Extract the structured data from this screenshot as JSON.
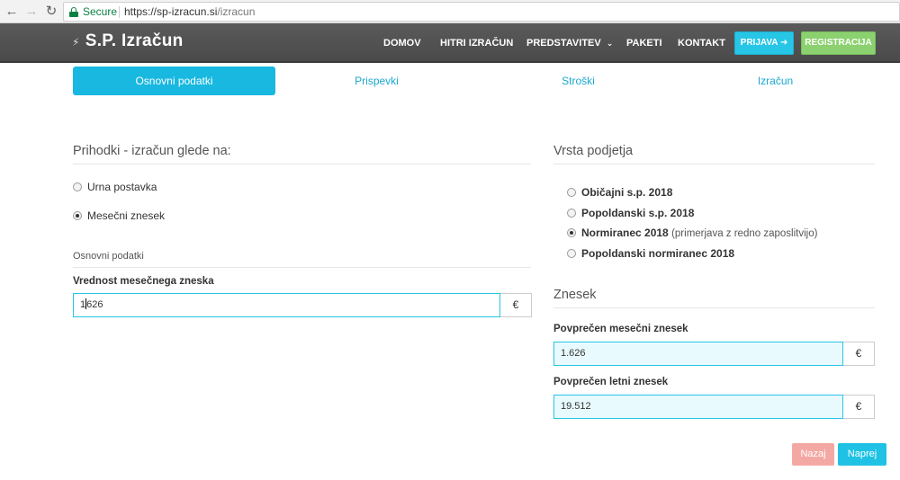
{
  "browser": {
    "security_label": "Secure",
    "url_host": "https://sp-izracun.si",
    "url_path": "/izracun"
  },
  "navbar": {
    "brand": "S.P. Izračun",
    "items": [
      "DOMOV",
      "HITRI IZRAČUN",
      "PREDSTAVITEV",
      "PAKETI",
      "KONTAKT"
    ],
    "login_label": "PRIJAVA",
    "register_label": "REGISTRACIJA"
  },
  "tabs": [
    "Osnovni podatki",
    "Prispevki",
    "Stroški",
    "Izračun"
  ],
  "left": {
    "section_title": "Prihodki - izračun glede na:",
    "radios": [
      {
        "label": "Urna postavka",
        "checked": false
      },
      {
        "label": "Mesečni znesek",
        "checked": true
      }
    ],
    "subsection_label": "Osnovni podatki",
    "field_label": "Vrednost mesečnega zneska",
    "field_value_before_cursor": "1",
    "field_value_after_cursor": "626",
    "currency": "€"
  },
  "right": {
    "section_title": "Vrsta podjetja",
    "radios": [
      {
        "label": "Običajni s.p. 2018",
        "note": "",
        "checked": false
      },
      {
        "label": "Popoldanski s.p. 2018",
        "note": "",
        "checked": false
      },
      {
        "label": "Normiranec 2018",
        "note": "(primerjava z redno zaposlitvijo)",
        "checked": true
      },
      {
        "label": "Popoldanski normiranec 2018",
        "note": "",
        "checked": false
      }
    ],
    "amount_title": "Znesek",
    "monthly_label": "Povprečen mesečni znesek",
    "monthly_value": "1.626",
    "yearly_label": "Povprečen letni znesek",
    "yearly_value": "19.512",
    "currency": "€"
  },
  "footer_buttons": {
    "back": "Nazaj",
    "next": "Naprej"
  },
  "colors": {
    "accent": "#18b8e0",
    "navbar": "#4e4e4e",
    "register": "#8bd16f",
    "back_button": "#f4a8a4"
  }
}
